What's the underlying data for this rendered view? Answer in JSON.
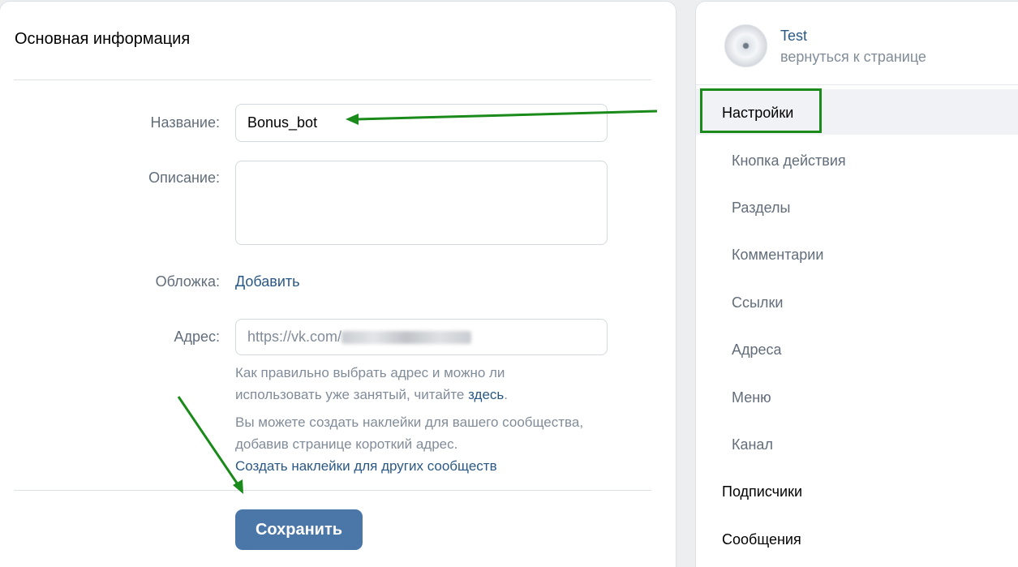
{
  "main": {
    "title": "Основная информация",
    "name_label": "Название:",
    "name_value": "Bonus_bot",
    "description_label": "Описание:",
    "description_value": "",
    "cover_label": "Обложка:",
    "cover_add": "Добавить",
    "address_label": "Адрес:",
    "address_prefix": "https://vk.com/",
    "address_hint_1": "Как правильно выбрать адрес и можно ли",
    "address_hint_2_pre": "использовать уже занятый, читайте ",
    "address_hint_2_link": "здесь",
    "address_hint_2_post": ".",
    "stickers_hint_1": "Вы можете создать наклейки для вашего сообщества,",
    "stickers_hint_2": "добавив странице короткий адрес.",
    "stickers_link": "Создать наклейки для других сообществ",
    "save_label": "Сохранить"
  },
  "sidebar": {
    "profile_name": "Test",
    "back_link": "вернуться к странице",
    "items": [
      {
        "label": "Настройки",
        "active": true
      },
      {
        "label": "Кнопка действия"
      },
      {
        "label": "Разделы"
      },
      {
        "label": "Комментарии"
      },
      {
        "label": "Ссылки"
      },
      {
        "label": "Адреса"
      },
      {
        "label": "Меню"
      },
      {
        "label": "Канал"
      },
      {
        "label": "Подписчики"
      },
      {
        "label": "Сообщения"
      }
    ]
  },
  "colors": {
    "accent": "#4a76a8",
    "link": "#2a5885",
    "annotation": "#1a8a1a"
  }
}
